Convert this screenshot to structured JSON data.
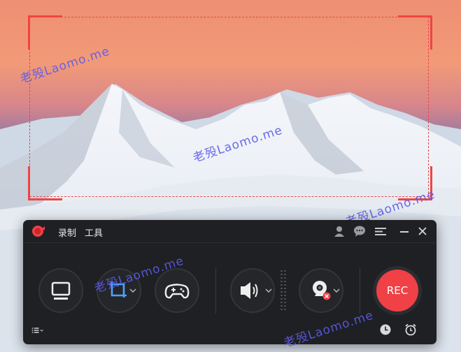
{
  "app": {
    "menu": [
      "录制",
      "工具"
    ]
  },
  "watermark": "老殁Laomo.me",
  "record_button": {
    "label": "REC"
  },
  "icons": {
    "title_bar": [
      "user-icon",
      "chat-icon",
      "hamburger-menu-icon",
      "minimize-icon",
      "close-icon"
    ],
    "capture": [
      "monitor-icon",
      "crop-region-icon",
      "gamepad-icon",
      "speaker-icon",
      "webcam-icon"
    ],
    "footer": [
      "list-icon",
      "clock-icon",
      "alarm-icon"
    ]
  },
  "colors": {
    "accent": "#ef4146",
    "crop_icon": "#4aa3ff",
    "panel": "#1f2023",
    "watermark": "#5b5be8"
  }
}
